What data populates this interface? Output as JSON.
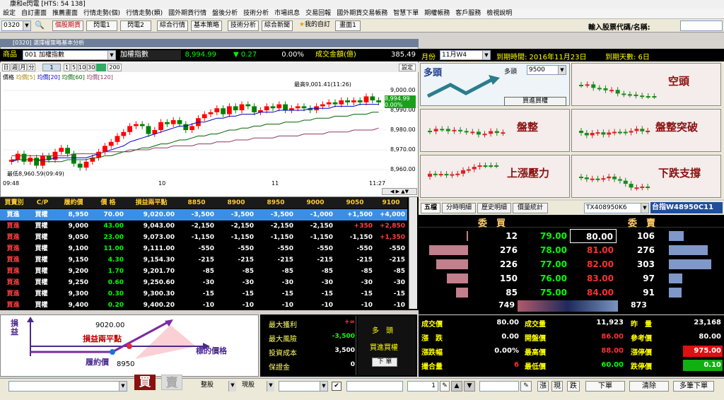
{
  "window": {
    "title": "康和e閃電 [HTS: 54 138]"
  },
  "menu": [
    "設定",
    "自訂畫面",
    "推薦畫面",
    "行情走勢(個)",
    "行情走勢(類)",
    "國外期貨行情",
    "盤後分析",
    "技術分析",
    "市場訊息",
    "交易回報",
    "國外期貨交易帳務",
    "智慧下單",
    "期權帳務",
    "客戶服務",
    "檢視說明"
  ],
  "toolbar": {
    "code": "0320",
    "buttons": [
      "個股期貨",
      "閃電1",
      "閃電2",
      "綜合行情",
      "基本策略",
      "技術分析",
      "綜合新聞"
    ],
    "favorite": "我的自訂",
    "page": "畫面1",
    "search_label": "輸入股票代碼/名稱:",
    "search_value": ""
  },
  "chart_panel": {
    "title": "[0320] 選擇權策略基本分析",
    "product_label": "商品",
    "product": "001 加權指數",
    "name": "加權指數",
    "price": "8,994.99",
    "change": "▼ 0.27",
    "pct": "0.00%",
    "amount_label": "成交金額(億)",
    "amount": "385.49",
    "periods": [
      "日",
      "週",
      "月",
      "分"
    ],
    "period_sel": "1",
    "intervals": [
      "1",
      "5",
      "10",
      "30"
    ],
    "count": "200",
    "settings": "設定",
    "legend": {
      "price": "價格",
      "ma5": "均價[5]",
      "ma20": "均價[20]",
      "ma60": "均價[60]",
      "ma120": "均價[120]"
    },
    "high_label": "最高9,001.41(11:26)",
    "low_label": "最低8,960.59(09:49)",
    "last_tag": "8,994.99",
    "last_pct": "0.00%",
    "y_ticks": [
      "9,000.00",
      "8,990.00",
      "8,980.00",
      "8,970.00",
      "8,960.00"
    ],
    "x_ticks": [
      "09:48",
      "10",
      "11",
      "11:27"
    ],
    "colors": {
      "up": "#ff0000",
      "down": "#008000",
      "ma20": "#0000cc",
      "ma60": "#006400",
      "ma120": "#8b3a62"
    }
  },
  "chart_data": {
    "type": "candlestick",
    "x_range": [
      "09:48",
      "11:27"
    ],
    "ylim": [
      8955,
      9005
    ],
    "high": 9001.41,
    "low": 8960.59,
    "last": 8994.99,
    "closes": [
      8965,
      8968,
      8964,
      8966,
      8962,
      8967,
      8965,
      8969,
      8971,
      8968,
      8963,
      8961,
      8964,
      8966,
      8969,
      8972,
      8974,
      8977,
      8979,
      8982,
      8983,
      8982,
      8978,
      8980,
      8984,
      8983,
      8985,
      8983,
      8980,
      8982,
      8986,
      8988,
      8989,
      8991,
      8988,
      8992,
      8990,
      8993,
      8992,
      8989,
      8990,
      8992,
      8991,
      8993,
      8990,
      8991,
      8992,
      8991,
      8990,
      8992,
      8993,
      8994,
      8993,
      8995,
      8994,
      8995,
      8994,
      8997,
      8995,
      8994
    ],
    "ma20": [
      8964,
      8965,
      8965,
      8965,
      8965,
      8965,
      8965,
      8966,
      8966,
      8966,
      8966,
      8966,
      8966,
      8967,
      8968,
      8969,
      8970,
      8971,
      8972,
      8974,
      8975,
      8976,
      8977,
      8978,
      8979,
      8980,
      8981,
      8982,
      8982,
      8983,
      8984,
      8984,
      8985,
      8986,
      8986,
      8987,
      8987,
      8988,
      8988,
      8988,
      8989,
      8989,
      8989,
      8990,
      8990,
      8990,
      8990,
      8990,
      8991,
      8991,
      8991,
      8991,
      8992,
      8992,
      8992,
      8992,
      8993,
      8993,
      8993,
      8993
    ],
    "ma60": [
      8965,
      8965,
      8965,
      8965,
      8965,
      8964,
      8964,
      8964,
      8964,
      8965,
      8965,
      8965,
      8965,
      8966,
      8966,
      8967,
      8967,
      8968,
      8969,
      8969,
      8970,
      8971,
      8971,
      8972,
      8973,
      8973,
      8974,
      8975,
      8975,
      8976,
      8977,
      8977,
      8978,
      8978,
      8979,
      8980,
      8980,
      8981,
      8981,
      8982,
      8982,
      8983,
      8983,
      8983,
      8984,
      8984,
      8984,
      8985,
      8985,
      8986,
      8986,
      8986,
      8987,
      8987,
      8987,
      8988,
      8988,
      8988,
      8989,
      8989
    ],
    "ma120": [
      8967,
      8967,
      8967,
      8967,
      8967,
      8967,
      8967,
      8967,
      8967,
      8967,
      8968,
      8968,
      8968,
      8968,
      8968,
      8969,
      8969,
      8969,
      8969,
      8970,
      8970,
      8970,
      8970,
      8971,
      8971,
      8971,
      8972,
      8972,
      8972,
      8972,
      8973,
      8973,
      8973,
      8974,
      8974,
      8974,
      8975,
      8975,
      8975,
      8976,
      8976,
      8976,
      8976,
      8977,
      8977,
      8977,
      8977,
      8978,
      8978,
      8978,
      8978,
      8979,
      8979,
      8979,
      8979,
      8980,
      8980,
      8980,
      8980,
      8981
    ]
  },
  "options_table": {
    "headers": [
      "買賣別",
      "C/P",
      "履約價",
      "價 格",
      "損益兩平點",
      "8850",
      "8900",
      "8950",
      "9000",
      "9050",
      "9100"
    ],
    "rows": [
      {
        "side": "買進",
        "cp": "買權",
        "strike": "8,950",
        "price": "70.00",
        "be": "9,020.00",
        "v": [
          "-3,500",
          "-3,500",
          "-3,500",
          "-1,000",
          "+1,500",
          "+4,000"
        ],
        "sel": true
      },
      {
        "side": "買進",
        "cp": "買權",
        "strike": "9,000",
        "price": "43.00",
        "be": "9,043.00",
        "v": [
          "-2,150",
          "-2,150",
          "-2,150",
          "-2,150",
          "+350",
          "+2,850"
        ]
      },
      {
        "side": "買進",
        "cp": "買權",
        "strike": "9,050",
        "price": "23.00",
        "be": "9,073.00",
        "v": [
          "-1,150",
          "-1,150",
          "-1,150",
          "-1,150",
          "-1,150",
          "+1,350"
        ]
      },
      {
        "side": "買進",
        "cp": "買權",
        "strike": "9,100",
        "price": "11.00",
        "be": "9,111.00",
        "v": [
          "-550",
          "-550",
          "-550",
          "-550",
          "-550",
          "-550"
        ]
      },
      {
        "side": "買進",
        "cp": "買權",
        "strike": "9,150",
        "price": "4.30",
        "be": "9,154.30",
        "v": [
          "-215",
          "-215",
          "-215",
          "-215",
          "-215",
          "-215"
        ]
      },
      {
        "side": "買進",
        "cp": "買權",
        "strike": "9,200",
        "price": "1.70",
        "be": "9,201.70",
        "v": [
          "-85",
          "-85",
          "-85",
          "-85",
          "-85",
          "-85"
        ]
      },
      {
        "side": "買進",
        "cp": "買權",
        "strike": "9,250",
        "price": "0.60",
        "be": "9,250.60",
        "v": [
          "-30",
          "-30",
          "-30",
          "-30",
          "-30",
          "-30"
        ]
      },
      {
        "side": "買進",
        "cp": "買權",
        "strike": "9,300",
        "price": "0.30",
        "be": "9,300.30",
        "v": [
          "-15",
          "-15",
          "-15",
          "-15",
          "-15",
          "-15"
        ]
      },
      {
        "side": "買進",
        "cp": "買權",
        "strike": "9,400",
        "price": "0.20",
        "be": "9,400.20",
        "v": [
          "-10",
          "-10",
          "-10",
          "-10",
          "-10",
          "-10"
        ]
      }
    ]
  },
  "payoff": {
    "y_label": "損益",
    "x_label": "標的價格",
    "be_label": "損益兩平點",
    "be_value": "9020.00",
    "strike_label": "履約價",
    "strike_value": "8950"
  },
  "risk": {
    "max_profit_label": "最大獲利",
    "max_profit": "+∞",
    "max_risk_label": "最大風險",
    "max_risk": "-3,500",
    "cost_label": "投資成本",
    "cost": "3,500",
    "margin_label": "保證金",
    "margin": "0",
    "direction": "多　頭",
    "strategy": "買進買權",
    "order_btn": "下 單"
  },
  "month_bar": {
    "label": "月份",
    "value": "11月W4",
    "expire": "到期時間: 2016年11月23日",
    "days": "到期天數: 6日"
  },
  "strategies": {
    "bull": "多頭",
    "bull_combo_label": "多頭",
    "bull_combo": "9500",
    "bull_btn": "買進買權",
    "bear": "空頭",
    "neutral": "盤整",
    "breakout": "盤整突破",
    "resist": "上漲壓力",
    "support": "下跌支撐"
  },
  "quote_tabs": [
    "五檔",
    "分時明細",
    "歷史明細",
    "價量統計"
  ],
  "contract": "TX408950K6",
  "warrant": "台指W48950C11",
  "quote": {
    "buy_header": "委　買",
    "sell_header": "委　賣",
    "levels": [
      {
        "bq": "12",
        "bp": "79.00",
        "sp": "80.00",
        "sq": "106"
      },
      {
        "bq": "276",
        "bp": "78.00",
        "sp": "81.00",
        "sq": "276"
      },
      {
        "bq": "226",
        "bp": "77.00",
        "sp": "82.00",
        "sq": "303"
      },
      {
        "bq": "150",
        "bp": "76.00",
        "sp": "83.00",
        "sq": "97"
      },
      {
        "bq": "85",
        "bp": "75.00",
        "sp": "84.00",
        "sq": "91"
      }
    ],
    "buy_total": "749",
    "sell_total": "873"
  },
  "stats": {
    "r1": [
      [
        "成交價",
        "80.00"
      ],
      [
        "成交量",
        "11,923"
      ],
      [
        "昨　量",
        "23,168"
      ]
    ],
    "r2": [
      [
        "漲　跌",
        "0.00"
      ],
      [
        "開盤價",
        "86.00"
      ],
      [
        "參考價",
        "80.00"
      ]
    ],
    "r3": [
      [
        "漲跌幅",
        "0.00%"
      ],
      [
        "最高價",
        "88.00"
      ],
      [
        "漲停價",
        "975.00"
      ]
    ],
    "r4": [
      [
        "撮合量",
        "6"
      ],
      [
        "最低價",
        "60.00"
      ],
      [
        "跌停價",
        "0.10"
      ]
    ]
  },
  "bottom": {
    "buy": "買",
    "sell": "賣",
    "type1": "整股",
    "type2": "現股",
    "qty": "1",
    "cash": "漲",
    "now": "現",
    "down": "跌",
    "order": "下單",
    "clear": "清除",
    "multi": "多筆下單"
  }
}
